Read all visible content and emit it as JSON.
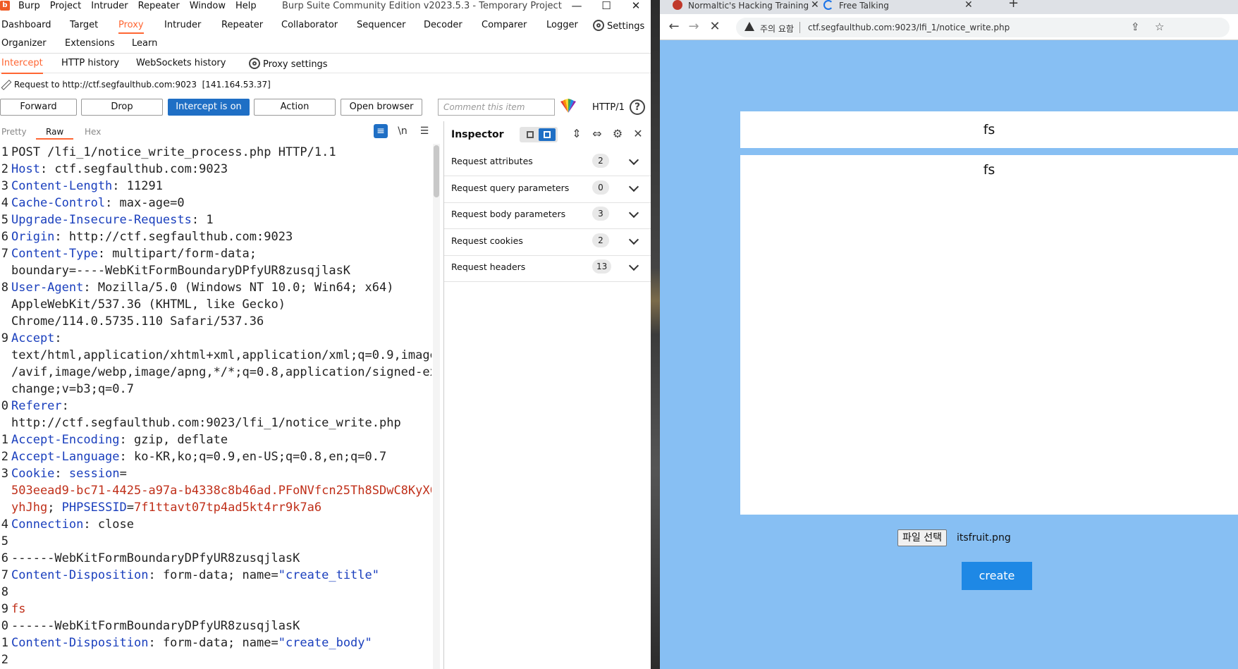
{
  "burp": {
    "menu": [
      "Burp",
      "Project",
      "Intruder",
      "Repeater",
      "Window",
      "Help"
    ],
    "window_title": "Burp Suite Community Edition v2023.5.3 - Temporary Project",
    "window_controls": [
      "—",
      "☐",
      "✕"
    ],
    "main_tabs_row1": [
      "Dashboard",
      "Target",
      "Proxy",
      "Intruder",
      "Repeater",
      "Collaborator",
      "Sequencer",
      "Decoder",
      "Comparer",
      "Logger",
      "Settings"
    ],
    "main_tabs_row2": [
      "Organizer",
      "Extensions",
      "Learn"
    ],
    "active_main_tab": "Proxy",
    "proxy_tabs": [
      "Intercept",
      "HTTP history",
      "WebSockets history",
      "Proxy settings"
    ],
    "request_to": "Request to http://ctf.segfaulthub.com:9023",
    "request_ip": "[141.164.53.37]",
    "buttons": {
      "forward": "Forward",
      "drop": "Drop",
      "intercept": "Intercept is on",
      "action": "Action",
      "open_browser": "Open browser"
    },
    "comment_placeholder": "Comment this item",
    "protocol": "HTTP/1",
    "editor_tabs": [
      "Pretty",
      "Raw",
      "Hex"
    ],
    "editor_icons": {
      "wrap": "≡",
      "newline": "\\n",
      "menu": "☰"
    },
    "request_lines": [
      {
        "n": "1",
        "parts": [
          [
            "",
            "POST /lfi_1/notice_write_process.php HTTP/1.1"
          ]
        ]
      },
      {
        "n": "2",
        "parts": [
          [
            "k",
            "Host"
          ],
          [
            "",
            ": ctf.segfaulthub.com:9023"
          ]
        ]
      },
      {
        "n": "3",
        "parts": [
          [
            "k",
            "Content-Length"
          ],
          [
            "",
            ": 11291"
          ]
        ]
      },
      {
        "n": "4",
        "parts": [
          [
            "k",
            "Cache-Control"
          ],
          [
            "",
            ": max-age=0"
          ]
        ]
      },
      {
        "n": "5",
        "parts": [
          [
            "k",
            "Upgrade-Insecure-Requests"
          ],
          [
            "",
            ": 1"
          ]
        ]
      },
      {
        "n": "6",
        "parts": [
          [
            "k",
            "Origin"
          ],
          [
            "",
            ": http://ctf.segfaulthub.com:9023"
          ]
        ]
      },
      {
        "n": "7",
        "parts": [
          [
            "k",
            "Content-Type"
          ],
          [
            "",
            ": multipart/form-data;"
          ]
        ]
      },
      {
        "n": "",
        "parts": [
          [
            "",
            "boundary=----WebKitFormBoundaryDPfyUR8zusqjlasK"
          ]
        ]
      },
      {
        "n": "8",
        "parts": [
          [
            "k",
            "User-Agent"
          ],
          [
            "",
            ": Mozilla/5.0 (Windows NT 10.0; Win64; x64)"
          ]
        ]
      },
      {
        "n": "",
        "parts": [
          [
            "",
            "AppleWebKit/537.36 (KHTML, like Gecko)"
          ]
        ]
      },
      {
        "n": "",
        "parts": [
          [
            "",
            "Chrome/114.0.5735.110 Safari/537.36"
          ]
        ]
      },
      {
        "n": "9",
        "parts": [
          [
            "k",
            "Accept"
          ],
          [
            "",
            ":"
          ]
        ]
      },
      {
        "n": "",
        "parts": [
          [
            "",
            "text/html,application/xhtml+xml,application/xml;q=0.9,image"
          ]
        ]
      },
      {
        "n": "",
        "parts": [
          [
            "",
            "/avif,image/webp,image/apng,*/*;q=0.8,application/signed-ex"
          ]
        ]
      },
      {
        "n": "",
        "parts": [
          [
            "",
            "change;v=b3;q=0.7"
          ]
        ]
      },
      {
        "n": "0",
        "parts": [
          [
            "k",
            "Referer"
          ],
          [
            "",
            ":"
          ]
        ]
      },
      {
        "n": "",
        "parts": [
          [
            "",
            "http://ctf.segfaulthub.com:9023/lfi_1/notice_write.php"
          ]
        ]
      },
      {
        "n": "1",
        "parts": [
          [
            "k",
            "Accept-Encoding"
          ],
          [
            "",
            ": gzip, deflate"
          ]
        ]
      },
      {
        "n": "2",
        "parts": [
          [
            "k",
            "Accept-Language"
          ],
          [
            "",
            ": ko-KR,ko;q=0.9,en-US;q=0.8,en;q=0.7"
          ]
        ]
      },
      {
        "n": "3",
        "parts": [
          [
            "k",
            "Cookie"
          ],
          [
            "",
            ": "
          ],
          [
            "k",
            "session"
          ],
          [
            "",
            "="
          ]
        ]
      },
      {
        "n": "",
        "parts": [
          [
            "r",
            "503eead9-bc71-4425-a97a-b4338c8b46ad.PFoNVfcn25Th8SDwC8KyXC"
          ]
        ]
      },
      {
        "n": "",
        "parts": [
          [
            "r",
            "yhJhg"
          ],
          [
            "",
            "; "
          ],
          [
            "k",
            "PHPSESSID"
          ],
          [
            "",
            "="
          ],
          [
            "r",
            "7f1ttavt07tp4ad5kt4rr9k7a6"
          ]
        ]
      },
      {
        "n": "4",
        "parts": [
          [
            "k",
            "Connection"
          ],
          [
            "",
            ": close"
          ]
        ]
      },
      {
        "n": "5",
        "parts": [
          [
            "",
            ""
          ]
        ]
      },
      {
        "n": "6",
        "parts": [
          [
            "",
            "------WebKitFormBoundaryDPfyUR8zusqjlasK"
          ]
        ]
      },
      {
        "n": "7",
        "parts": [
          [
            "k",
            "Content-Disposition"
          ],
          [
            "",
            ": form-data; name="
          ],
          [
            "k",
            "\"create_title\""
          ]
        ]
      },
      {
        "n": "8",
        "parts": [
          [
            "",
            ""
          ]
        ]
      },
      {
        "n": "9",
        "parts": [
          [
            "r",
            "fs"
          ]
        ]
      },
      {
        "n": "0",
        "parts": [
          [
            "",
            "------WebKitFormBoundaryDPfyUR8zusqjlasK"
          ]
        ]
      },
      {
        "n": "1",
        "parts": [
          [
            "k",
            "Content-Disposition"
          ],
          [
            "",
            ": form-data; name="
          ],
          [
            "k",
            "\"create_body\""
          ]
        ]
      },
      {
        "n": "2",
        "parts": [
          [
            "",
            ""
          ]
        ]
      }
    ],
    "inspector": {
      "title": "Inspector",
      "sections": [
        {
          "label": "Request attributes",
          "count": "2"
        },
        {
          "label": "Request query parameters",
          "count": "0"
        },
        {
          "label": "Request body parameters",
          "count": "3"
        },
        {
          "label": "Request cookies",
          "count": "2"
        },
        {
          "label": "Request headers",
          "count": "13"
        }
      ]
    },
    "accent_color": "#ff6633",
    "button_blue": "#1f6fc5"
  },
  "browser": {
    "tabs": [
      {
        "title": "Normaltic's Hacking Training",
        "favicon_color": "#c0392b"
      },
      {
        "title": "Free Talking",
        "favicon_color": "#1a73e8"
      }
    ],
    "security_warning": "주의 요함",
    "url": "ctf.segfaulthub.com:9023/lfi_1/notice_write.php",
    "page": {
      "title_value": "fs",
      "body_value": "fs",
      "file_button": "파일 선택",
      "file_name": "itsfruit.png",
      "create_button": "create"
    },
    "page_background": "#87bff3",
    "create_color": "#1e88e5"
  }
}
